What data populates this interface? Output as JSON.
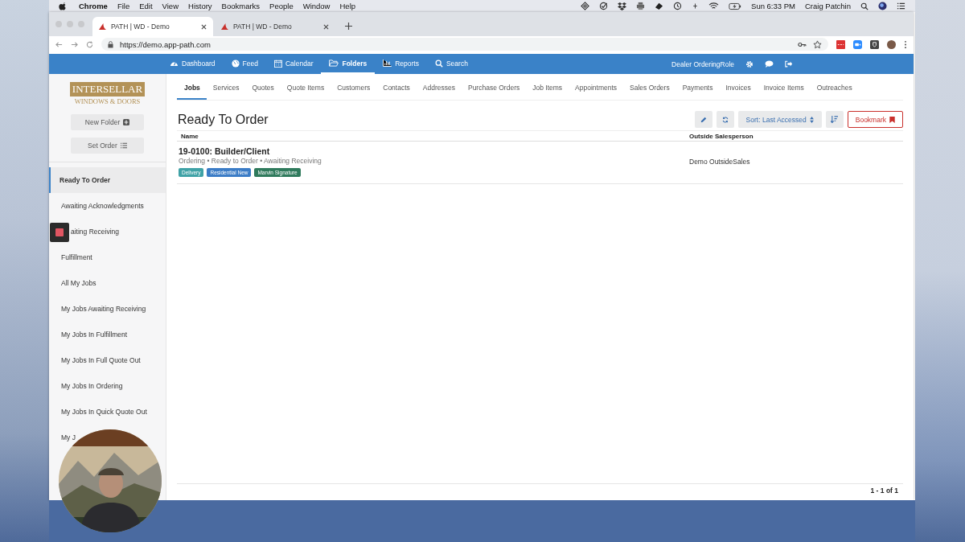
{
  "menu_bar": {
    "app": "Chrome",
    "items": [
      "File",
      "Edit",
      "View",
      "History",
      "Bookmarks",
      "People",
      "Window",
      "Help"
    ],
    "clock": "Sun 6:33 PM",
    "user": "Craig Patchin"
  },
  "browser": {
    "tabs": [
      {
        "title": "PATH | WD - Demo",
        "selected": true
      },
      {
        "title": "PATH | WD - Demo",
        "selected": false
      }
    ],
    "url": "https://demo.app-path.com"
  },
  "nav": {
    "items": [
      {
        "label": "Dashboard",
        "selected": false
      },
      {
        "label": "Feed",
        "selected": false
      },
      {
        "label": "Calendar",
        "selected": false
      },
      {
        "label": "Folders",
        "selected": true
      },
      {
        "label": "Reports",
        "selected": false
      },
      {
        "label": "Search",
        "selected": false
      }
    ],
    "role": "Dealer OrderingRole"
  },
  "sidebar": {
    "logo": {
      "line1": "INTERSELLAR",
      "line2": "WINDOWS & DOORS"
    },
    "buttons": [
      "New Folder",
      "Set Order"
    ],
    "items": [
      {
        "label": "Ready To Order",
        "selected": true,
        "covered": false
      },
      {
        "label": "Awaiting Acknowledgments",
        "selected": false,
        "covered": false
      },
      {
        "label": "aiting Receiving",
        "selected": false,
        "covered": true
      },
      {
        "label": "Fulfillment",
        "selected": false,
        "covered": false
      },
      {
        "label": "All My Jobs",
        "selected": false,
        "covered": false
      },
      {
        "label": "My Jobs Awaiting Receiving",
        "selected": false,
        "covered": false
      },
      {
        "label": "My Jobs In Fulfillment",
        "selected": false,
        "covered": false
      },
      {
        "label": "My Jobs In Full Quote Out",
        "selected": false,
        "covered": false
      },
      {
        "label": "My Jobs In Ordering",
        "selected": false,
        "covered": false
      },
      {
        "label": "My Jobs In Quick Quote Out",
        "selected": false,
        "covered": false
      },
      {
        "label": "My J",
        "selected": false,
        "covered": false
      }
    ]
  },
  "subtabs": [
    {
      "label": "Jobs",
      "selected": true
    },
    {
      "label": "Services",
      "selected": false
    },
    {
      "label": "Quotes",
      "selected": false
    },
    {
      "label": "Quote Items",
      "selected": false
    },
    {
      "label": "Customers",
      "selected": false
    },
    {
      "label": "Contacts",
      "selected": false
    },
    {
      "label": "Addresses",
      "selected": false
    },
    {
      "label": "Purchase Orders",
      "selected": false
    },
    {
      "label": "Job Items",
      "selected": false
    },
    {
      "label": "Appointments",
      "selected": false
    },
    {
      "label": "Sales Orders",
      "selected": false
    },
    {
      "label": "Payments",
      "selected": false
    },
    {
      "label": "Invoices",
      "selected": false
    },
    {
      "label": "Invoice Items",
      "selected": false
    },
    {
      "label": "Outreaches",
      "selected": false
    }
  ],
  "page": {
    "title": "Ready To Order",
    "sort": "Sort: Last Accessed",
    "bookmark": "Bookmark"
  },
  "table": {
    "columns": [
      "Name",
      "Outside Salesperson"
    ],
    "rows": [
      {
        "title": "19-0100: Builder/Client",
        "status": "Ordering • Ready to Order • Awaiting Receiving",
        "tags": [
          {
            "label": "Delivery",
            "color": "#3fa2a6"
          },
          {
            "label": "Residential New",
            "color": "#3b7cc6"
          },
          {
            "label": "Marvin Signature",
            "color": "#2f7a5c"
          }
        ],
        "salesperson": "Demo OutsideSales"
      }
    ]
  },
  "pagination": "1 - 1 of 1"
}
